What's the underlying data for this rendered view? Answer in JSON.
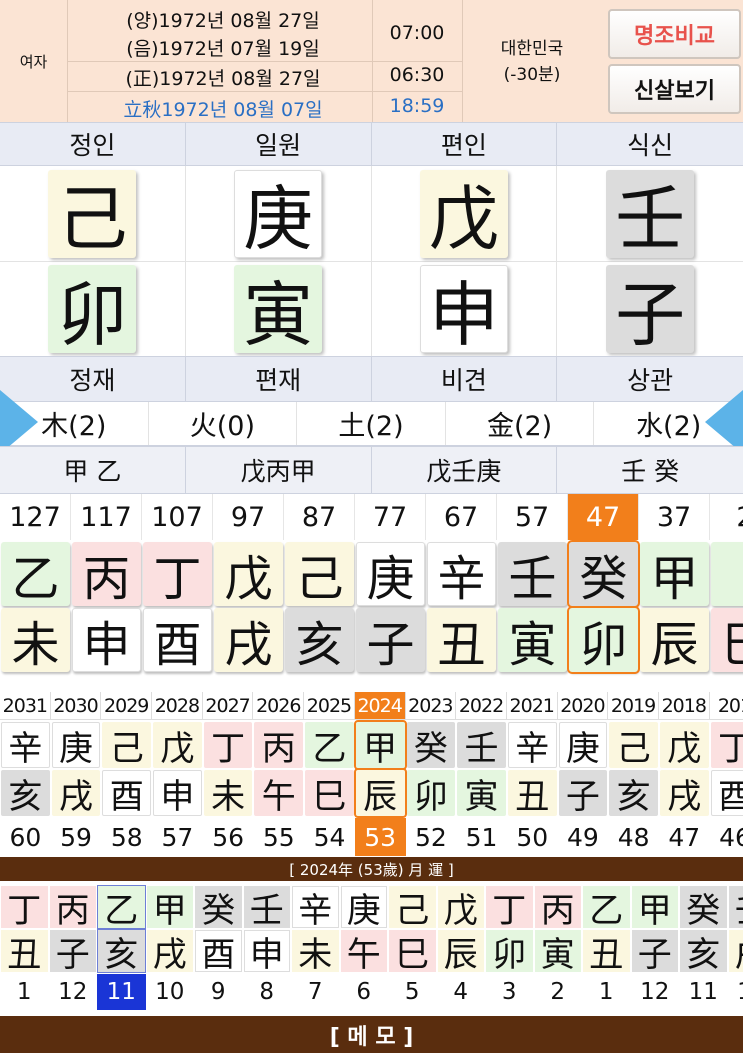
{
  "header": {
    "gender": "여자",
    "solar": "(양)1972년 08월 27일",
    "lunar": "(음)1972년 07월 19일",
    "corrected": "(正)1972년 08월 27일",
    "solar_term": "立秋1972년 08월 07일",
    "time1": "07:00",
    "time2": "06:30",
    "time3": "18:59",
    "country": "대한민국",
    "offset": "(-30분)",
    "compare_button": "명조비교",
    "sinsal_button": "신살보기"
  },
  "top_labels": [
    "정인",
    "일원",
    "편인",
    "식신"
  ],
  "stems": [
    {
      "char": "己",
      "color": "yellow"
    },
    {
      "char": "庚",
      "color": "white"
    },
    {
      "char": "戊",
      "color": "yellow"
    },
    {
      "char": "壬",
      "color": "gray"
    }
  ],
  "branches": [
    {
      "char": "卯",
      "color": "green"
    },
    {
      "char": "寅",
      "color": "green"
    },
    {
      "char": "申",
      "color": "white"
    },
    {
      "char": "子",
      "color": "gray"
    }
  ],
  "bottom_labels": [
    "정재",
    "편재",
    "비견",
    "상관"
  ],
  "elements": [
    "木(2)",
    "火(0)",
    "土(2)",
    "金(2)",
    "水(2)"
  ],
  "hidden_stems": [
    "甲 乙",
    "戊丙甲",
    "戊壬庚",
    "壬 癸"
  ],
  "daeun": [
    {
      "age": "127",
      "stem": "乙",
      "sc": "green",
      "branch": "未",
      "bc": "yellow"
    },
    {
      "age": "117",
      "stem": "丙",
      "sc": "pink",
      "branch": "申",
      "bc": "white"
    },
    {
      "age": "107",
      "stem": "丁",
      "sc": "pink",
      "branch": "酉",
      "bc": "white"
    },
    {
      "age": "97",
      "stem": "戊",
      "sc": "yellow",
      "branch": "戌",
      "bc": "yellow"
    },
    {
      "age": "87",
      "stem": "己",
      "sc": "yellow",
      "branch": "亥",
      "bc": "gray"
    },
    {
      "age": "77",
      "stem": "庚",
      "sc": "white",
      "branch": "子",
      "bc": "gray"
    },
    {
      "age": "67",
      "stem": "辛",
      "sc": "white",
      "branch": "丑",
      "bc": "yellow"
    },
    {
      "age": "57",
      "stem": "壬",
      "sc": "gray",
      "branch": "寅",
      "bc": "green"
    },
    {
      "age": "47",
      "stem": "癸",
      "sc": "gray",
      "branch": "卯",
      "bc": "green",
      "selected": true
    },
    {
      "age": "37",
      "stem": "甲",
      "sc": "green",
      "branch": "辰",
      "bc": "yellow"
    },
    {
      "age": "2",
      "stem": "",
      "sc": "green",
      "branch": "巳",
      "bc": "pink"
    }
  ],
  "years": [
    {
      "year": "2031",
      "stem": "辛",
      "sc": "white",
      "branch": "亥",
      "bc": "gray",
      "age": "60"
    },
    {
      "year": "2030",
      "stem": "庚",
      "sc": "white",
      "branch": "戌",
      "bc": "yellow",
      "age": "59"
    },
    {
      "year": "2029",
      "stem": "己",
      "sc": "yellow",
      "branch": "酉",
      "bc": "white",
      "age": "58"
    },
    {
      "year": "2028",
      "stem": "戊",
      "sc": "yellow",
      "branch": "申",
      "bc": "white",
      "age": "57"
    },
    {
      "year": "2027",
      "stem": "丁",
      "sc": "pink",
      "branch": "未",
      "bc": "yellow",
      "age": "56"
    },
    {
      "year": "2026",
      "stem": "丙",
      "sc": "pink",
      "branch": "午",
      "bc": "pink",
      "age": "55"
    },
    {
      "year": "2025",
      "stem": "乙",
      "sc": "green",
      "branch": "巳",
      "bc": "pink",
      "age": "54"
    },
    {
      "year": "2024",
      "stem": "甲",
      "sc": "green",
      "branch": "辰",
      "bc": "yellow",
      "age": "53",
      "selected": true
    },
    {
      "year": "2023",
      "stem": "癸",
      "sc": "gray",
      "branch": "卯",
      "bc": "green",
      "age": "52"
    },
    {
      "year": "2022",
      "stem": "壬",
      "sc": "gray",
      "branch": "寅",
      "bc": "green",
      "age": "51"
    },
    {
      "year": "2021",
      "stem": "辛",
      "sc": "white",
      "branch": "丑",
      "bc": "yellow",
      "age": "50"
    },
    {
      "year": "2020",
      "stem": "庚",
      "sc": "white",
      "branch": "子",
      "bc": "gray",
      "age": "49"
    },
    {
      "year": "2019",
      "stem": "己",
      "sc": "yellow",
      "branch": "亥",
      "bc": "gray",
      "age": "48"
    },
    {
      "year": "2018",
      "stem": "戊",
      "sc": "yellow",
      "branch": "戌",
      "bc": "yellow",
      "age": "47"
    },
    {
      "year": "201",
      "stem": "丁",
      "sc": "pink",
      "branch": "酉",
      "bc": "white",
      "age": "46"
    }
  ],
  "month_title": "[ 2024年 (53歲) 月 運 ]",
  "months": [
    {
      "num": "1",
      "stem": "丁",
      "sc": "pink",
      "branch": "丑",
      "bc": "yellow"
    },
    {
      "num": "12",
      "stem": "丙",
      "sc": "pink",
      "branch": "子",
      "bc": "gray"
    },
    {
      "num": "11",
      "stem": "乙",
      "sc": "green",
      "branch": "亥",
      "bc": "gray",
      "selected": true
    },
    {
      "num": "10",
      "stem": "甲",
      "sc": "green",
      "branch": "戌",
      "bc": "yellow"
    },
    {
      "num": "9",
      "stem": "癸",
      "sc": "gray",
      "branch": "酉",
      "bc": "white"
    },
    {
      "num": "8",
      "stem": "壬",
      "sc": "gray",
      "branch": "申",
      "bc": "white"
    },
    {
      "num": "7",
      "stem": "辛",
      "sc": "white",
      "branch": "未",
      "bc": "yellow"
    },
    {
      "num": "6",
      "stem": "庚",
      "sc": "white",
      "branch": "午",
      "bc": "pink"
    },
    {
      "num": "5",
      "stem": "己",
      "sc": "yellow",
      "branch": "巳",
      "bc": "pink"
    },
    {
      "num": "4",
      "stem": "戊",
      "sc": "yellow",
      "branch": "辰",
      "bc": "yellow"
    },
    {
      "num": "3",
      "stem": "丁",
      "sc": "pink",
      "branch": "卯",
      "bc": "green"
    },
    {
      "num": "2",
      "stem": "丙",
      "sc": "pink",
      "branch": "寅",
      "bc": "green"
    },
    {
      "num": "1",
      "stem": "乙",
      "sc": "green",
      "branch": "丑",
      "bc": "yellow"
    },
    {
      "num": "12",
      "stem": "甲",
      "sc": "green",
      "branch": "子",
      "bc": "gray"
    },
    {
      "num": "11",
      "stem": "癸",
      "sc": "gray",
      "branch": "亥",
      "bc": "gray"
    },
    {
      "num": "10",
      "stem": "壬",
      "sc": "gray",
      "branch": "戌",
      "bc": "yellow"
    }
  ],
  "memo_label": "[ 메  모 ]",
  "colors": {
    "accent": "#f27f1b",
    "brown": "#5a2d0e",
    "blue_select": "#1a35d6",
    "link_blue": "#2a6fc4"
  }
}
